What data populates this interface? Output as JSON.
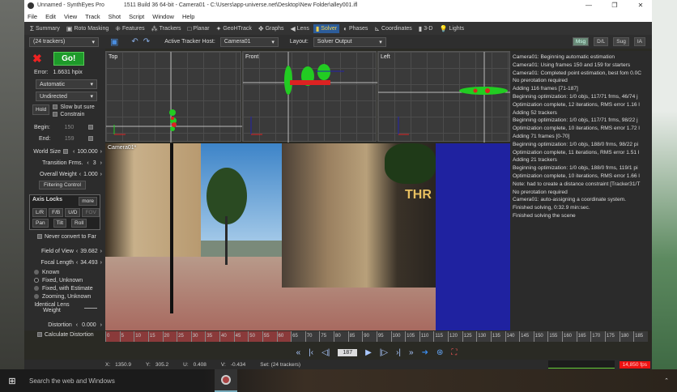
{
  "window": {
    "app_title": "Unnamed - SynthEyes Pro",
    "build_info": "1511 Build 36 64-bit - Camera01 - C:\\Users\\app-universe.net\\Desktop\\New Folder\\alley001.ifl",
    "minimize": "—",
    "maximize": "❐",
    "close": "✕"
  },
  "menu": [
    "File",
    "Edit",
    "View",
    "Track",
    "Shot",
    "Script",
    "Window",
    "Help"
  ],
  "tabs": [
    {
      "label": "Summary",
      "icon": "Σ"
    },
    {
      "label": "Roto Masking",
      "icon": "▣"
    },
    {
      "label": "Features",
      "icon": "⁜"
    },
    {
      "label": "Trackers",
      "icon": "⁂"
    },
    {
      "label": "Planar",
      "icon": "□"
    },
    {
      "label": "GeoHTrack",
      "icon": "✦"
    },
    {
      "label": "Graphs",
      "icon": "✥"
    },
    {
      "label": "Lens",
      "icon": "◀"
    },
    {
      "label": "Solver",
      "icon": "▮"
    },
    {
      "label": "Phases",
      "icon": "◐"
    },
    {
      "label": "Coordinates",
      "icon": "⊾"
    },
    {
      "label": "3-D",
      "icon": "▮"
    },
    {
      "label": "Lights",
      "icon": "💡"
    }
  ],
  "toolbar": {
    "tracker_set": "(24 trackers)",
    "active_host_label": "Active Tracker Host:",
    "active_host": "Camera01",
    "layout_label": "Layout:",
    "layout": "Solver Output",
    "mode_buttons": [
      "Msg",
      "D/L",
      "Sug",
      "IA"
    ]
  },
  "solver": {
    "go": "Go!",
    "error_label": "Error:",
    "error_value": "1.6631 hpix",
    "mode": "Automatic",
    "direction": "Undirected",
    "hold": "Hold",
    "slow_but_sure": "Slow but sure",
    "constrain": "Constrain",
    "begin_label": "Begin:",
    "begin_value": "150",
    "end_label": "End:",
    "end_value": "159",
    "world_size_label": "World Size",
    "world_size": "100.000",
    "transition_label": "Transition Frms.",
    "transition": "3",
    "overall_weight_label": "Overall Weight",
    "overall_weight": "1.000",
    "filtering": "Filtering Control",
    "axis_locks": "Axis Locks",
    "more": "more",
    "locks": [
      "L/R",
      "F/B",
      "U/D",
      "FOV",
      "Pan",
      "Tilt",
      "Roll"
    ],
    "never_convert": "Never convert to Far",
    "fov_label": "Field of View",
    "fov": "39.682",
    "focal_label": "Focal Length",
    "focal": "34.493",
    "lens_modes": [
      "Known",
      "Fixed, Unknown",
      "Fixed, with Estimate",
      "Zooming, Unknown"
    ],
    "lens_weight_label": "Identical Lens Weight",
    "distortion_label": "Distortion",
    "distortion": "0.000",
    "calc_distortion": "Calculate Distortion"
  },
  "viewports": {
    "top": "Top",
    "front": "Front",
    "left": "Left",
    "camera": "Camera01*",
    "overlay_text": "THR"
  },
  "log": [
    "Camera01: Beginning automatic estimation",
    "Camera01: Using frames 150 and 159 for starters",
    "Camera01: Completed point estimation, best fom 0.0C",
    "No prerotation required",
    "Adding 116 frames [71-187]",
    "Beginning optimization: 1/0 objs, 117/71 frms, 46/74 j",
    "Optimization complete, 12 iterations, RMS error 1.16 l",
    "Adding 52 trackers",
    "Beginning optimization: 1/0 objs, 117/71 frms, 98/22 j",
    "Optimization complete, 10 iterations, RMS error 1.72 l",
    "Adding 71 frames [0-70]",
    "Beginning optimization: 1/0 objs, 188/0 frms, 98/22 pi",
    "Optimization complete, 11 iterations, RMS error 1.51 l",
    "Adding 21 trackers",
    "Beginning optimization: 1/0 objs, 188/0 frms, 119/1 pi",
    "Optimization complete, 10 iterations, RMS error 1.66 l",
    "Note: had to create a distance constraint [Tracker31/T",
    "No prerotation required",
    "Camera01: auto-assigning a coordinate system.",
    "Finished solving, 0:32.9 min:sec.",
    "Finished solving the scene"
  ],
  "timeline": {
    "ticks": [
      "0",
      "5",
      "10",
      "15",
      "20",
      "25",
      "30",
      "35",
      "40",
      "45",
      "50",
      "55",
      "60",
      "65",
      "70",
      "75",
      "80",
      "85",
      "90",
      "95",
      "100",
      "105",
      "110",
      "115",
      "120",
      "125",
      "130",
      "135",
      "140",
      "145",
      "150",
      "155",
      "160",
      "165",
      "170",
      "175",
      "180",
      "185"
    ],
    "solved_fraction": 0.33
  },
  "playback": {
    "frame": "187",
    "buttons": [
      "«",
      "|‹",
      "◁|",
      "▶",
      "|▷",
      "›|",
      "»"
    ]
  },
  "status": {
    "x_label": "X:",
    "x": "1350.9",
    "y_label": "Y:",
    "y": "305.2",
    "u_label": "U:",
    "u": "0.408",
    "v_label": "V:",
    "v": "-0.434",
    "set": "Set: (24 trackers)",
    "perf": "14,850 fps"
  },
  "taskbar": {
    "search": "Search the web and Windows"
  },
  "colors": {
    "accent": "#2c5c9a",
    "go": "#1e9a2a",
    "error_badge": "#ee1111"
  }
}
